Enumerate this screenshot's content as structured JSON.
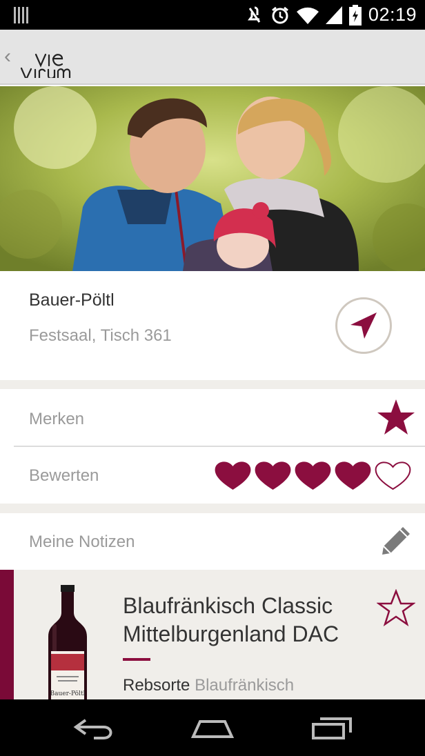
{
  "status_bar": {
    "time": "02:19"
  },
  "app": {
    "back_symbol": "‹"
  },
  "producer": {
    "name": "Bauer-Pöltl",
    "location": "Festsaal, Tisch 361"
  },
  "actions": {
    "merken_label": "Merken",
    "bewerten_label": "Bewerten",
    "notes_label": "Meine Notizen",
    "rating": 4,
    "rating_max": 5
  },
  "wine": {
    "name": "Blaufränkisch Classic Mittelburgenland DAC",
    "meta_key": "Rebsorte",
    "meta_value": "Blaufränkisch",
    "bottle_label": "Bauer-Pöltl"
  },
  "colors": {
    "accent": "#8b0e3f",
    "bg_gray": "#f0eeea"
  },
  "icons": [
    "back-chevron-icon",
    "navigate-arrow-icon",
    "star-solid-icon",
    "heart-icon",
    "pencil-icon",
    "star-outline-icon",
    "back-icon",
    "home-icon",
    "recents-icon"
  ]
}
